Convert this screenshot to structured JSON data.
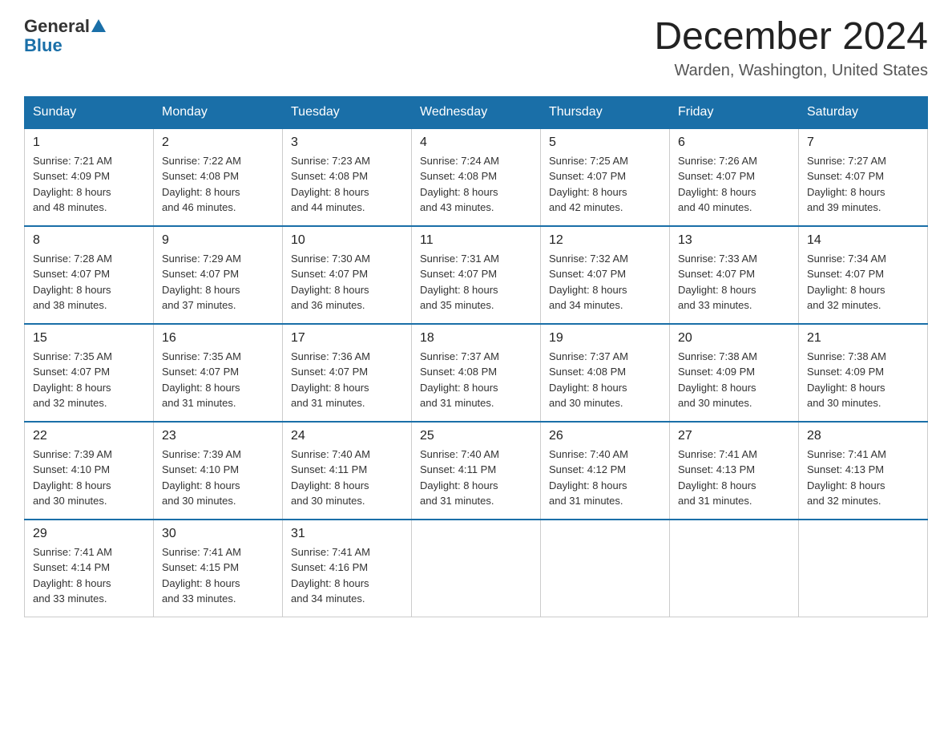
{
  "header": {
    "logo_general": "General",
    "logo_blue": "Blue",
    "month_title": "December 2024",
    "location": "Warden, Washington, United States"
  },
  "days_of_week": [
    "Sunday",
    "Monday",
    "Tuesday",
    "Wednesday",
    "Thursday",
    "Friday",
    "Saturday"
  ],
  "weeks": [
    [
      {
        "day": "1",
        "sunrise": "7:21 AM",
        "sunset": "4:09 PM",
        "daylight": "8 hours and 48 minutes."
      },
      {
        "day": "2",
        "sunrise": "7:22 AM",
        "sunset": "4:08 PM",
        "daylight": "8 hours and 46 minutes."
      },
      {
        "day": "3",
        "sunrise": "7:23 AM",
        "sunset": "4:08 PM",
        "daylight": "8 hours and 44 minutes."
      },
      {
        "day": "4",
        "sunrise": "7:24 AM",
        "sunset": "4:08 PM",
        "daylight": "8 hours and 43 minutes."
      },
      {
        "day": "5",
        "sunrise": "7:25 AM",
        "sunset": "4:07 PM",
        "daylight": "8 hours and 42 minutes."
      },
      {
        "day": "6",
        "sunrise": "7:26 AM",
        "sunset": "4:07 PM",
        "daylight": "8 hours and 40 minutes."
      },
      {
        "day": "7",
        "sunrise": "7:27 AM",
        "sunset": "4:07 PM",
        "daylight": "8 hours and 39 minutes."
      }
    ],
    [
      {
        "day": "8",
        "sunrise": "7:28 AM",
        "sunset": "4:07 PM",
        "daylight": "8 hours and 38 minutes."
      },
      {
        "day": "9",
        "sunrise": "7:29 AM",
        "sunset": "4:07 PM",
        "daylight": "8 hours and 37 minutes."
      },
      {
        "day": "10",
        "sunrise": "7:30 AM",
        "sunset": "4:07 PM",
        "daylight": "8 hours and 36 minutes."
      },
      {
        "day": "11",
        "sunrise": "7:31 AM",
        "sunset": "4:07 PM",
        "daylight": "8 hours and 35 minutes."
      },
      {
        "day": "12",
        "sunrise": "7:32 AM",
        "sunset": "4:07 PM",
        "daylight": "8 hours and 34 minutes."
      },
      {
        "day": "13",
        "sunrise": "7:33 AM",
        "sunset": "4:07 PM",
        "daylight": "8 hours and 33 minutes."
      },
      {
        "day": "14",
        "sunrise": "7:34 AM",
        "sunset": "4:07 PM",
        "daylight": "8 hours and 32 minutes."
      }
    ],
    [
      {
        "day": "15",
        "sunrise": "7:35 AM",
        "sunset": "4:07 PM",
        "daylight": "8 hours and 32 minutes."
      },
      {
        "day": "16",
        "sunrise": "7:35 AM",
        "sunset": "4:07 PM",
        "daylight": "8 hours and 31 minutes."
      },
      {
        "day": "17",
        "sunrise": "7:36 AM",
        "sunset": "4:07 PM",
        "daylight": "8 hours and 31 minutes."
      },
      {
        "day": "18",
        "sunrise": "7:37 AM",
        "sunset": "4:08 PM",
        "daylight": "8 hours and 31 minutes."
      },
      {
        "day": "19",
        "sunrise": "7:37 AM",
        "sunset": "4:08 PM",
        "daylight": "8 hours and 30 minutes."
      },
      {
        "day": "20",
        "sunrise": "7:38 AM",
        "sunset": "4:09 PM",
        "daylight": "8 hours and 30 minutes."
      },
      {
        "day": "21",
        "sunrise": "7:38 AM",
        "sunset": "4:09 PM",
        "daylight": "8 hours and 30 minutes."
      }
    ],
    [
      {
        "day": "22",
        "sunrise": "7:39 AM",
        "sunset": "4:10 PM",
        "daylight": "8 hours and 30 minutes."
      },
      {
        "day": "23",
        "sunrise": "7:39 AM",
        "sunset": "4:10 PM",
        "daylight": "8 hours and 30 minutes."
      },
      {
        "day": "24",
        "sunrise": "7:40 AM",
        "sunset": "4:11 PM",
        "daylight": "8 hours and 30 minutes."
      },
      {
        "day": "25",
        "sunrise": "7:40 AM",
        "sunset": "4:11 PM",
        "daylight": "8 hours and 31 minutes."
      },
      {
        "day": "26",
        "sunrise": "7:40 AM",
        "sunset": "4:12 PM",
        "daylight": "8 hours and 31 minutes."
      },
      {
        "day": "27",
        "sunrise": "7:41 AM",
        "sunset": "4:13 PM",
        "daylight": "8 hours and 31 minutes."
      },
      {
        "day": "28",
        "sunrise": "7:41 AM",
        "sunset": "4:13 PM",
        "daylight": "8 hours and 32 minutes."
      }
    ],
    [
      {
        "day": "29",
        "sunrise": "7:41 AM",
        "sunset": "4:14 PM",
        "daylight": "8 hours and 33 minutes."
      },
      {
        "day": "30",
        "sunrise": "7:41 AM",
        "sunset": "4:15 PM",
        "daylight": "8 hours and 33 minutes."
      },
      {
        "day": "31",
        "sunrise": "7:41 AM",
        "sunset": "4:16 PM",
        "daylight": "8 hours and 34 minutes."
      },
      null,
      null,
      null,
      null
    ]
  ],
  "labels": {
    "sunrise": "Sunrise:",
    "sunset": "Sunset:",
    "daylight": "Daylight:"
  }
}
